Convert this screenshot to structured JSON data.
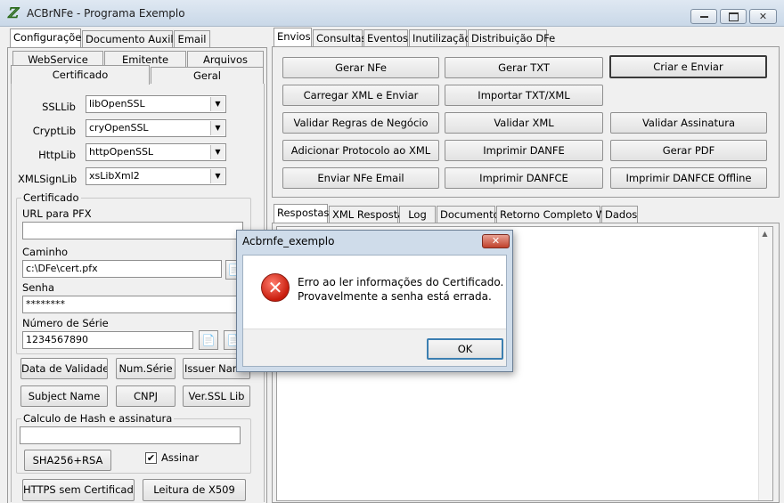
{
  "window": {
    "title": "ACBrNFe - Programa Exemplo",
    "minimize": "▭",
    "maximize": "□",
    "close": "✕"
  },
  "left_tabs": [
    "Configurações",
    "Documento Auxiliar",
    "Email"
  ],
  "sub_tabs_row1": [
    "WebService",
    "Emitente",
    "Arquivos"
  ],
  "sub_tabs_row2": [
    "Certificado",
    "Geral"
  ],
  "certificado": {
    "ssllib_label": "SSLLib",
    "ssllib_value": "libOpenSSL",
    "cryptlib_label": "CryptLib",
    "cryptlib_value": "cryOpenSSL",
    "httplib_label": "HttpLib",
    "httplib_value": "httpOpenSSL",
    "xmlsignlib_label": "XMLSignLib",
    "xmlsignlib_value": "xsLibXml2",
    "group_caption": "Certificado",
    "url_pfx_label": "URL para PFX",
    "url_pfx_value": "",
    "caminho_label": "Caminho",
    "caminho_value": "c:\\DFe\\cert.pfx",
    "senha_label": "Senha",
    "senha_value": "********",
    "numserie_label": "Número de Série",
    "numserie_value": "1234567890"
  },
  "cert_buttons": [
    "Data de Validade",
    "Num.Série",
    "Issuer Name",
    "Subject Name",
    "CNPJ",
    "Ver.SSL Lib"
  ],
  "hash": {
    "group_caption": "Calculo de Hash e assinatura",
    "input_value": "",
    "sha_button": "SHA256+RSA",
    "assinar_label": "Assinar",
    "assinar_checked": "✔"
  },
  "bottom_buttons": [
    "HTTPS sem Certificado",
    "Leitura de X509"
  ],
  "right_tabs": [
    "Envios",
    "Consultas",
    "Eventos",
    "Inutilização",
    "Distribuição DFe"
  ],
  "envios_buttons": [
    "Gerar NFe",
    "Gerar TXT",
    "Criar e Enviar",
    "Carregar XML e Enviar",
    "Importar TXT/XML",
    "Validar Regras de Negócio",
    "Validar XML",
    "Validar Assinatura",
    "Adicionar Protocolo ao XML",
    "Imprimir DANFE",
    "Gerar PDF",
    "Enviar NFe Email",
    "Imprimir DANFCE",
    "Imprimir DANFCE Offline"
  ],
  "result_tabs": [
    "Respostas",
    "XML Resposta",
    "Log",
    "Documento",
    "Retorno Completo WS",
    "Dados"
  ],
  "dialog": {
    "title": "Acbrnfe_exemplo",
    "close": "✕",
    "message_line1": "Erro ao ler informações do Certificado.",
    "message_line2": "Provavelmente a senha está errada.",
    "ok": "OK",
    "icon_glyph": "✕"
  },
  "icons": {
    "app": "acbr-app-icon",
    "file_button": "📄"
  }
}
